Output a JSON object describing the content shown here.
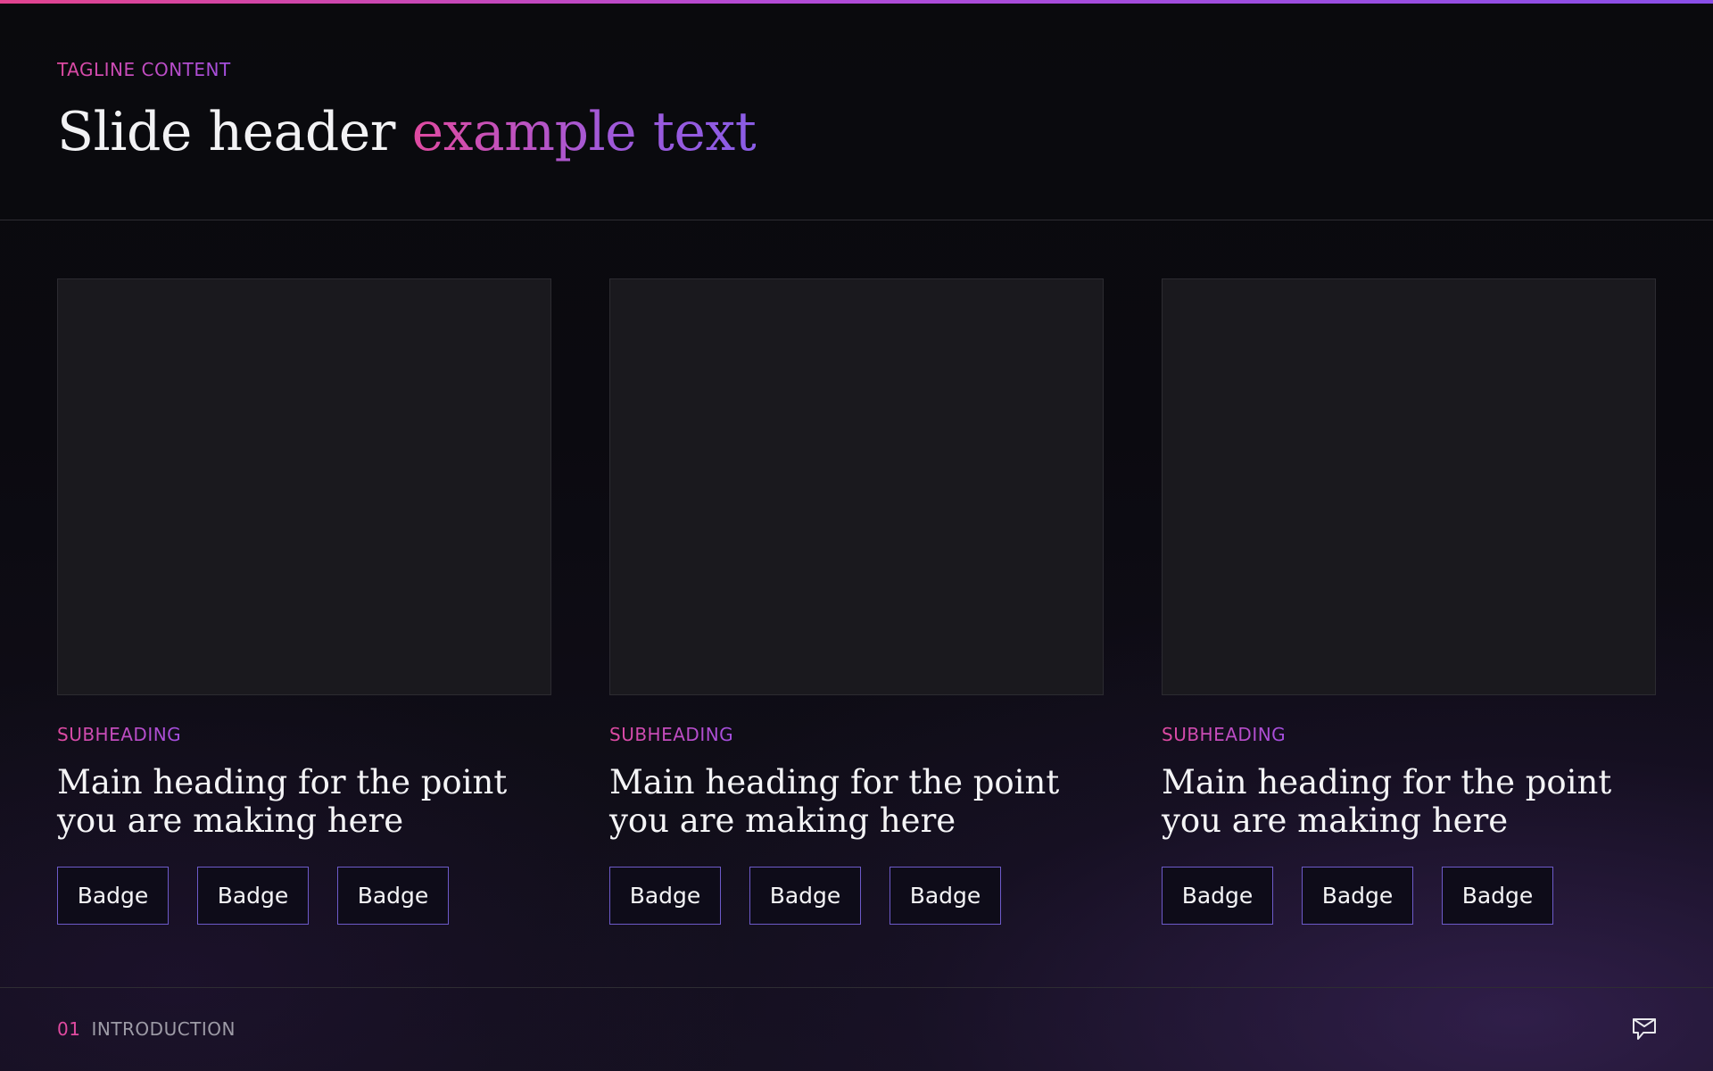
{
  "header": {
    "tagline": "TAGLINE CONTENT",
    "title_main": "Slide header ",
    "title_accent": "example text"
  },
  "cards": [
    {
      "subheading": "SUBHEADING",
      "heading": "Main heading for the point you are making here",
      "badges": [
        "Badge",
        "Badge",
        "Badge"
      ]
    },
    {
      "subheading": "SUBHEADING",
      "heading": "Main heading for the point you are making here",
      "badges": [
        "Badge",
        "Badge",
        "Badge"
      ]
    },
    {
      "subheading": "SUBHEADING",
      "heading": "Main heading for the point you are making here",
      "badges": [
        "Badge",
        "Badge",
        "Badge"
      ]
    }
  ],
  "footer": {
    "section_number": "01",
    "section_label": "INTRODUCTION",
    "logo_icon": "chat-bubble-logo-icon"
  },
  "colors": {
    "accent_pink": "#e04aa0",
    "accent_purple": "#8a4fe8",
    "badge_border": "#6d5ac9",
    "background": "#0a0a0d",
    "divider": "#2e2d33"
  }
}
